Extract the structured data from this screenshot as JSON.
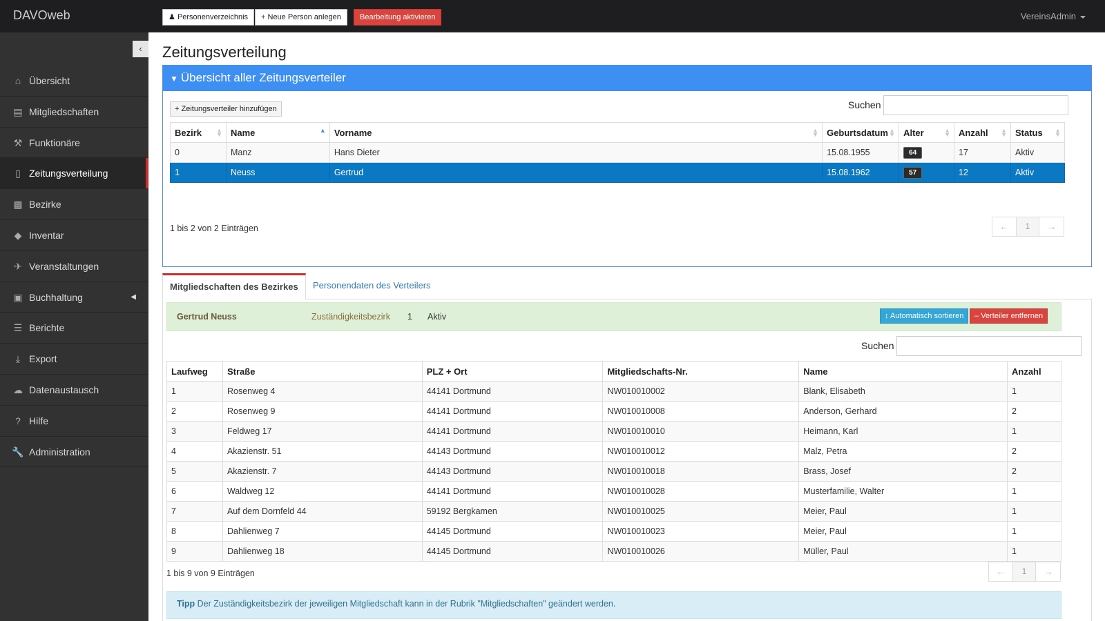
{
  "app": {
    "brand": "DAVOweb",
    "user": "VereinsAdmin"
  },
  "topbar": {
    "buttons": [
      {
        "icon": "users-icon",
        "label": "Personenverzeichnis"
      },
      {
        "icon": "plus-icon",
        "label": "Neue Person anlegen"
      },
      {
        "label": "Bearbeitung aktivieren"
      }
    ]
  },
  "sidebar": {
    "items": [
      {
        "icon": "home-icon",
        "label": "Übersicht"
      },
      {
        "icon": "book-icon",
        "label": "Mitgliedschaften"
      },
      {
        "icon": "gavel-icon",
        "label": "Funktionäre"
      },
      {
        "icon": "file-icon",
        "label": "Zeitungsverteilung",
        "active": true
      },
      {
        "icon": "briefcase-icon",
        "label": "Bezirke"
      },
      {
        "icon": "tags-icon",
        "label": "Inventar"
      },
      {
        "icon": "plane-icon",
        "label": "Veranstaltungen"
      },
      {
        "icon": "money-icon",
        "label": "Buchhaltung",
        "has_submenu": true
      },
      {
        "icon": "list-icon",
        "label": "Berichte"
      },
      {
        "icon": "download-icon",
        "label": "Export"
      },
      {
        "icon": "cloud-icon",
        "label": "Datenaustausch"
      },
      {
        "icon": "question-icon",
        "label": "Hilfe"
      },
      {
        "icon": "wrench-icon",
        "label": "Administration"
      }
    ]
  },
  "page": {
    "title": "Zeitungsverteilung"
  },
  "panel": {
    "title": "Übersicht aller Zeitungsverteiler",
    "add_button": "Zeitungsverteiler hinzufügen",
    "search_label": "Suchen",
    "search_value": "",
    "columns": [
      "Bezirk",
      "Name",
      "Vorname",
      "Geburtsdatum",
      "Alter",
      "Anzahl",
      "Status"
    ],
    "rows": [
      {
        "bezirk": "0",
        "name": "Manz",
        "vorname": "Hans Dieter",
        "geburtsdatum": "15.08.1955",
        "alter": "64",
        "anzahl": "17",
        "status": "Aktiv"
      },
      {
        "bezirk": "1",
        "name": "Neuss",
        "vorname": "Gertrud",
        "geburtsdatum": "15.08.1962",
        "alter": "57",
        "anzahl": "12",
        "status": "Aktiv",
        "selected": true
      }
    ],
    "info": "1 bis 2 von 2 Einträgen",
    "pager": {
      "prev": "←",
      "page": "1",
      "next": "→"
    }
  },
  "tabs": [
    {
      "label": "Mitgliedschaften des Bezirkes",
      "active": true
    },
    {
      "label": "Personendaten des Verteilers"
    }
  ],
  "district": {
    "name": "Gertrud Neuss",
    "label": "Zuständigkeitsbezirk",
    "number": "1",
    "status": "Aktiv",
    "sort_button": "Automatisch sortieren",
    "remove_button": "Verteiler entfernen",
    "search_label": "Suchen",
    "search_value": "",
    "columns": [
      "Laufweg",
      "Straße",
      "PLZ + Ort",
      "Mitgliedschafts-Nr.",
      "Name",
      "Anzahl"
    ],
    "rows": [
      [
        "1",
        "Rosenweg 4",
        "44141 Dortmund",
        "NW010010002",
        "Blank, Elisabeth",
        "1"
      ],
      [
        "2",
        "Rosenweg 9",
        "44141 Dortmund",
        "NW010010008",
        "Anderson, Gerhard",
        "2"
      ],
      [
        "3",
        "Feldweg 17",
        "44141 Dortmund",
        "NW010010010",
        "Heimann, Karl",
        "1"
      ],
      [
        "4",
        "Akazienstr. 51",
        "44143 Dortmund",
        "NW010010012",
        "Malz, Petra",
        "2"
      ],
      [
        "5",
        "Akazienstr. 7",
        "44143 Dortmund",
        "NW010010018",
        "Brass, Josef",
        "2"
      ],
      [
        "6",
        "Waldweg 12",
        "44141 Dortmund",
        "NW010010028",
        "Musterfamilie, Walter",
        "1"
      ],
      [
        "7",
        "Auf dem Dornfeld 44",
        "59192 Bergkamen",
        "NW010010025",
        "Meier, Paul",
        "1"
      ],
      [
        "8",
        "Dahlienweg 7",
        "44145 Dortmund",
        "NW010010023",
        "Meier, Paul",
        "1"
      ],
      [
        "9",
        "Dahlienweg 18",
        "44145 Dortmund",
        "NW010010026",
        "Müller, Paul",
        "1"
      ]
    ],
    "info": "1 bis 9 von 9 Einträgen",
    "pager": {
      "prev": "←",
      "page": "1",
      "next": "→"
    }
  },
  "tip": {
    "label": "Tipp",
    "text": "Der Zuständigkeitsbezirk der jeweiligen Mitgliedschaft kann in der Rubrik \"Mitgliedschaften\" geändert werden."
  }
}
